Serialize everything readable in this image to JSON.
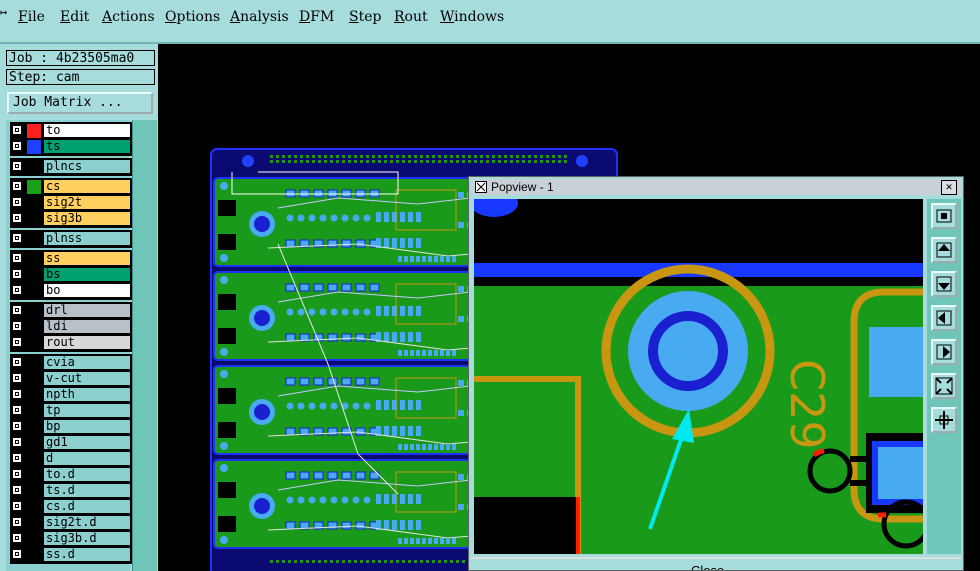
{
  "menubar": {
    "items": [
      "File",
      "Edit",
      "Actions",
      "Options",
      "Analysis",
      "DFM",
      "Step",
      "Rout",
      "Windows"
    ]
  },
  "panel": {
    "job": "Job : 4b23505ma0",
    "step": "Step: cam",
    "matrix_button": "Job Matrix ..."
  },
  "layers": [
    {
      "name": "to",
      "swatch": "#ff2020",
      "bg": "#ffffff"
    },
    {
      "name": "ts",
      "swatch": "#2040ff",
      "bg": "#00a070"
    },
    {
      "name": "plncs",
      "swatch": "#000000",
      "bg": "#8ccfcf"
    },
    {
      "name": "cs",
      "swatch": "#18a018",
      "bg": "#ffd060"
    },
    {
      "name": "sig2t",
      "swatch": "#000000",
      "bg": "#ffd060"
    },
    {
      "name": "sig3b",
      "swatch": "#000000",
      "bg": "#ffd060"
    },
    {
      "name": "plnss",
      "swatch": "#000000",
      "bg": "#8ccfcf"
    },
    {
      "name": "ss",
      "swatch": "#000000",
      "bg": "#ffd060"
    },
    {
      "name": "bs",
      "swatch": "#000000",
      "bg": "#00a070"
    },
    {
      "name": "bo",
      "swatch": "#000000",
      "bg": "#ffffff"
    },
    {
      "name": "drl",
      "swatch": "#000000",
      "bg": "#b8c0c8"
    },
    {
      "name": "ldi",
      "swatch": "#000000",
      "bg": "#b8c0c8"
    },
    {
      "name": "rout",
      "swatch": "#000000",
      "bg": "#d8d8d8"
    },
    {
      "name": "cvia",
      "swatch": "#000000",
      "bg": "#8ccfcf"
    },
    {
      "name": "v-cut",
      "swatch": "#000000",
      "bg": "#8ccfcf"
    },
    {
      "name": "npth",
      "swatch": "#000000",
      "bg": "#8ccfcf"
    },
    {
      "name": "tp",
      "swatch": "#000000",
      "bg": "#8ccfcf"
    },
    {
      "name": "bp",
      "swatch": "#000000",
      "bg": "#8ccfcf"
    },
    {
      "name": "gd1",
      "swatch": "#000000",
      "bg": "#8ccfcf"
    },
    {
      "name": "d",
      "swatch": "#000000",
      "bg": "#8ccfcf"
    },
    {
      "name": "to.d",
      "swatch": "#000000",
      "bg": "#8ccfcf"
    },
    {
      "name": "ts.d",
      "swatch": "#000000",
      "bg": "#8ccfcf"
    },
    {
      "name": "cs.d",
      "swatch": "#000000",
      "bg": "#8ccfcf"
    },
    {
      "name": "sig2t.d",
      "swatch": "#000000",
      "bg": "#8ccfcf"
    },
    {
      "name": "sig3b.d",
      "swatch": "#000000",
      "bg": "#8ccfcf"
    },
    {
      "name": "ss.d",
      "swatch": "#000000",
      "bg": "#8ccfcf"
    }
  ],
  "popview": {
    "title": "Popview - 1",
    "close_glyph": "✕",
    "bottom_label": "Close",
    "silk_text": "C29"
  },
  "colors": {
    "ui": "#a6dcdc",
    "board": "#1a9a1a",
    "copper": "#c89610",
    "pad": "#48aaf0",
    "drill": "#1a20d0",
    "blue_trace": "#1838ff",
    "arrow": "#00e8f0"
  }
}
